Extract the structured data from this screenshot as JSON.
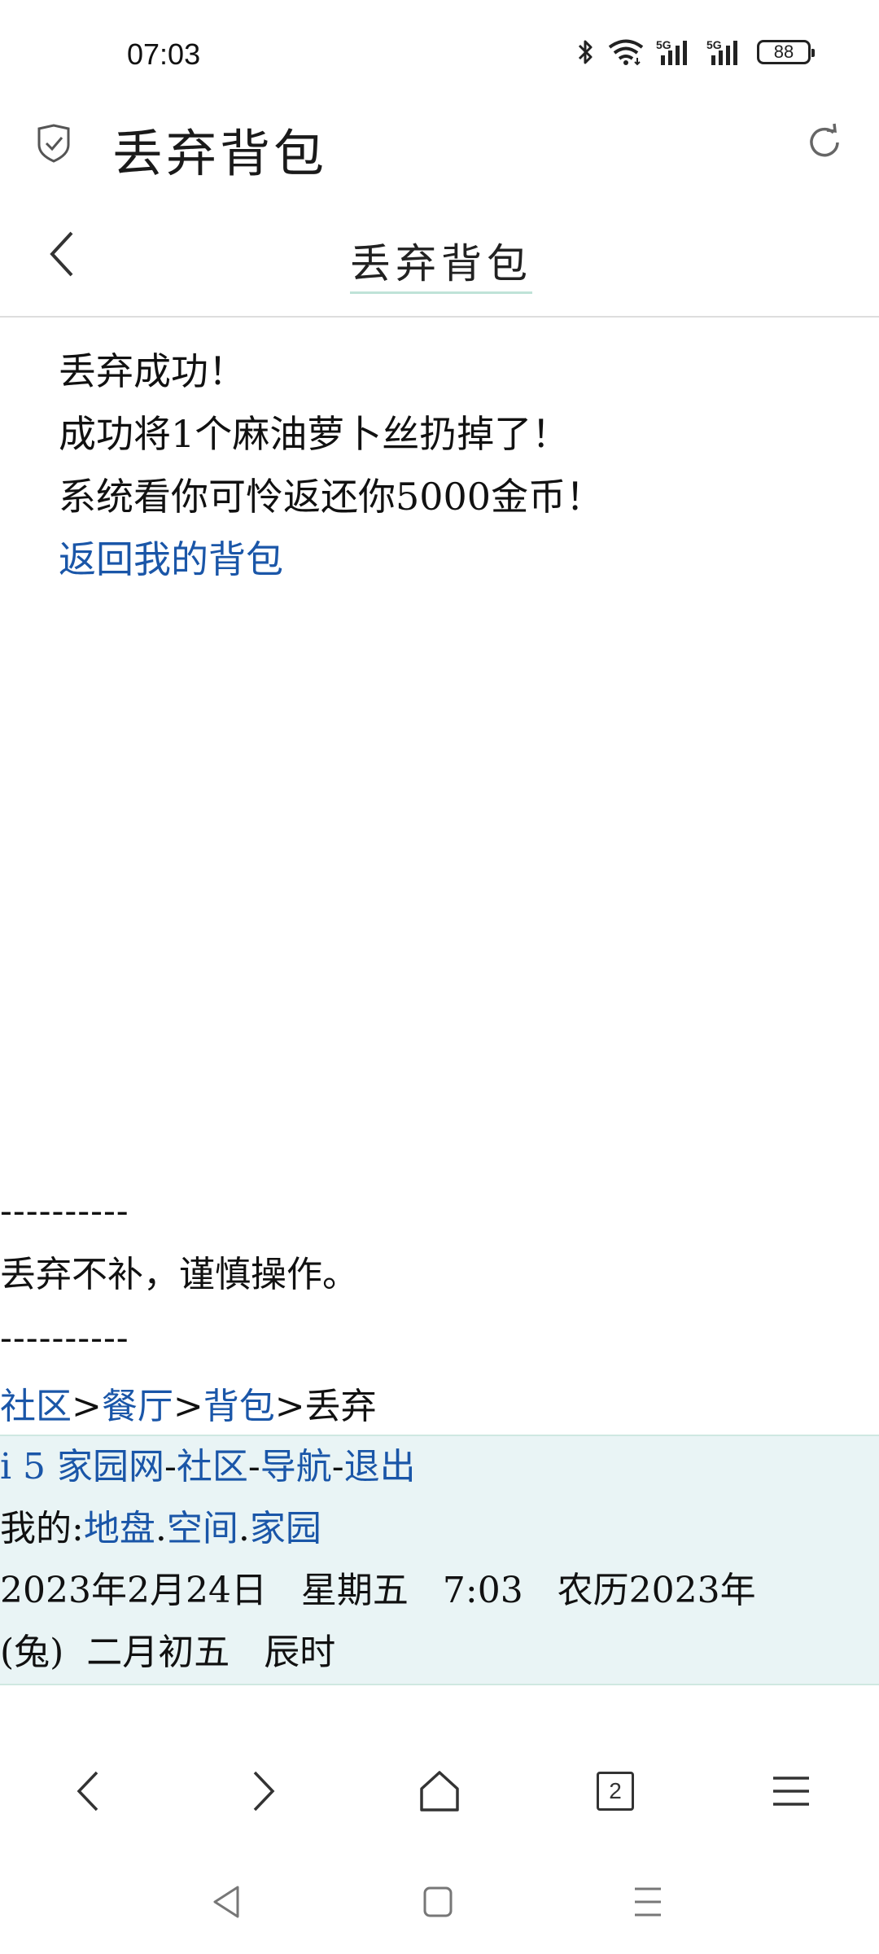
{
  "status_bar": {
    "time": "07:03",
    "battery": "88",
    "icons": [
      "bluetooth-icon",
      "wifi-icon",
      "signal-5g-icon",
      "signal-5g-icon",
      "battery-icon"
    ]
  },
  "header": {
    "app_title": "丢弃背包",
    "icons": [
      "shield-icon",
      "refresh-icon"
    ]
  },
  "page": {
    "title": "丢弃背包",
    "back_icon": "chevron-left-icon"
  },
  "content": {
    "line1": "丢弃成功！",
    "line2": "成功将1个麻油萝卜丝扔掉了！",
    "line3": "系统看你可怜返还你5000金币！",
    "back_link": "返回我的背包"
  },
  "footer": {
    "dashes": "----------",
    "notice": "丢弃不补，谨慎操作。",
    "breadcrumb": {
      "items": [
        "社区",
        "餐厅",
        "背包"
      ],
      "separator": ">",
      "current": "丢弃"
    }
  },
  "info_box": {
    "site": "i 5 家园网",
    "links": [
      "社区",
      "导航",
      "退出"
    ],
    "dash": "-",
    "mine_label": "我的:",
    "mine_links": [
      "地盘",
      "空间",
      "家园"
    ],
    "dot": ".",
    "date_line": "2023年2月24日   星期五   7:03   农历2023年",
    "lunar_line": "(兔)  二月初五   辰时"
  },
  "browser_toolbar": {
    "tabs_count": "2",
    "icons": [
      "back-arrow-icon",
      "forward-arrow-icon",
      "home-icon",
      "tabs-icon",
      "menu-icon"
    ]
  },
  "system_nav": {
    "icons": [
      "nav-back-icon",
      "nav-home-icon",
      "nav-recents-icon"
    ]
  },
  "colors": {
    "link": "#1a56a8",
    "info_bg": "#e9f4f5",
    "title_underline": "#bfe3d8"
  }
}
